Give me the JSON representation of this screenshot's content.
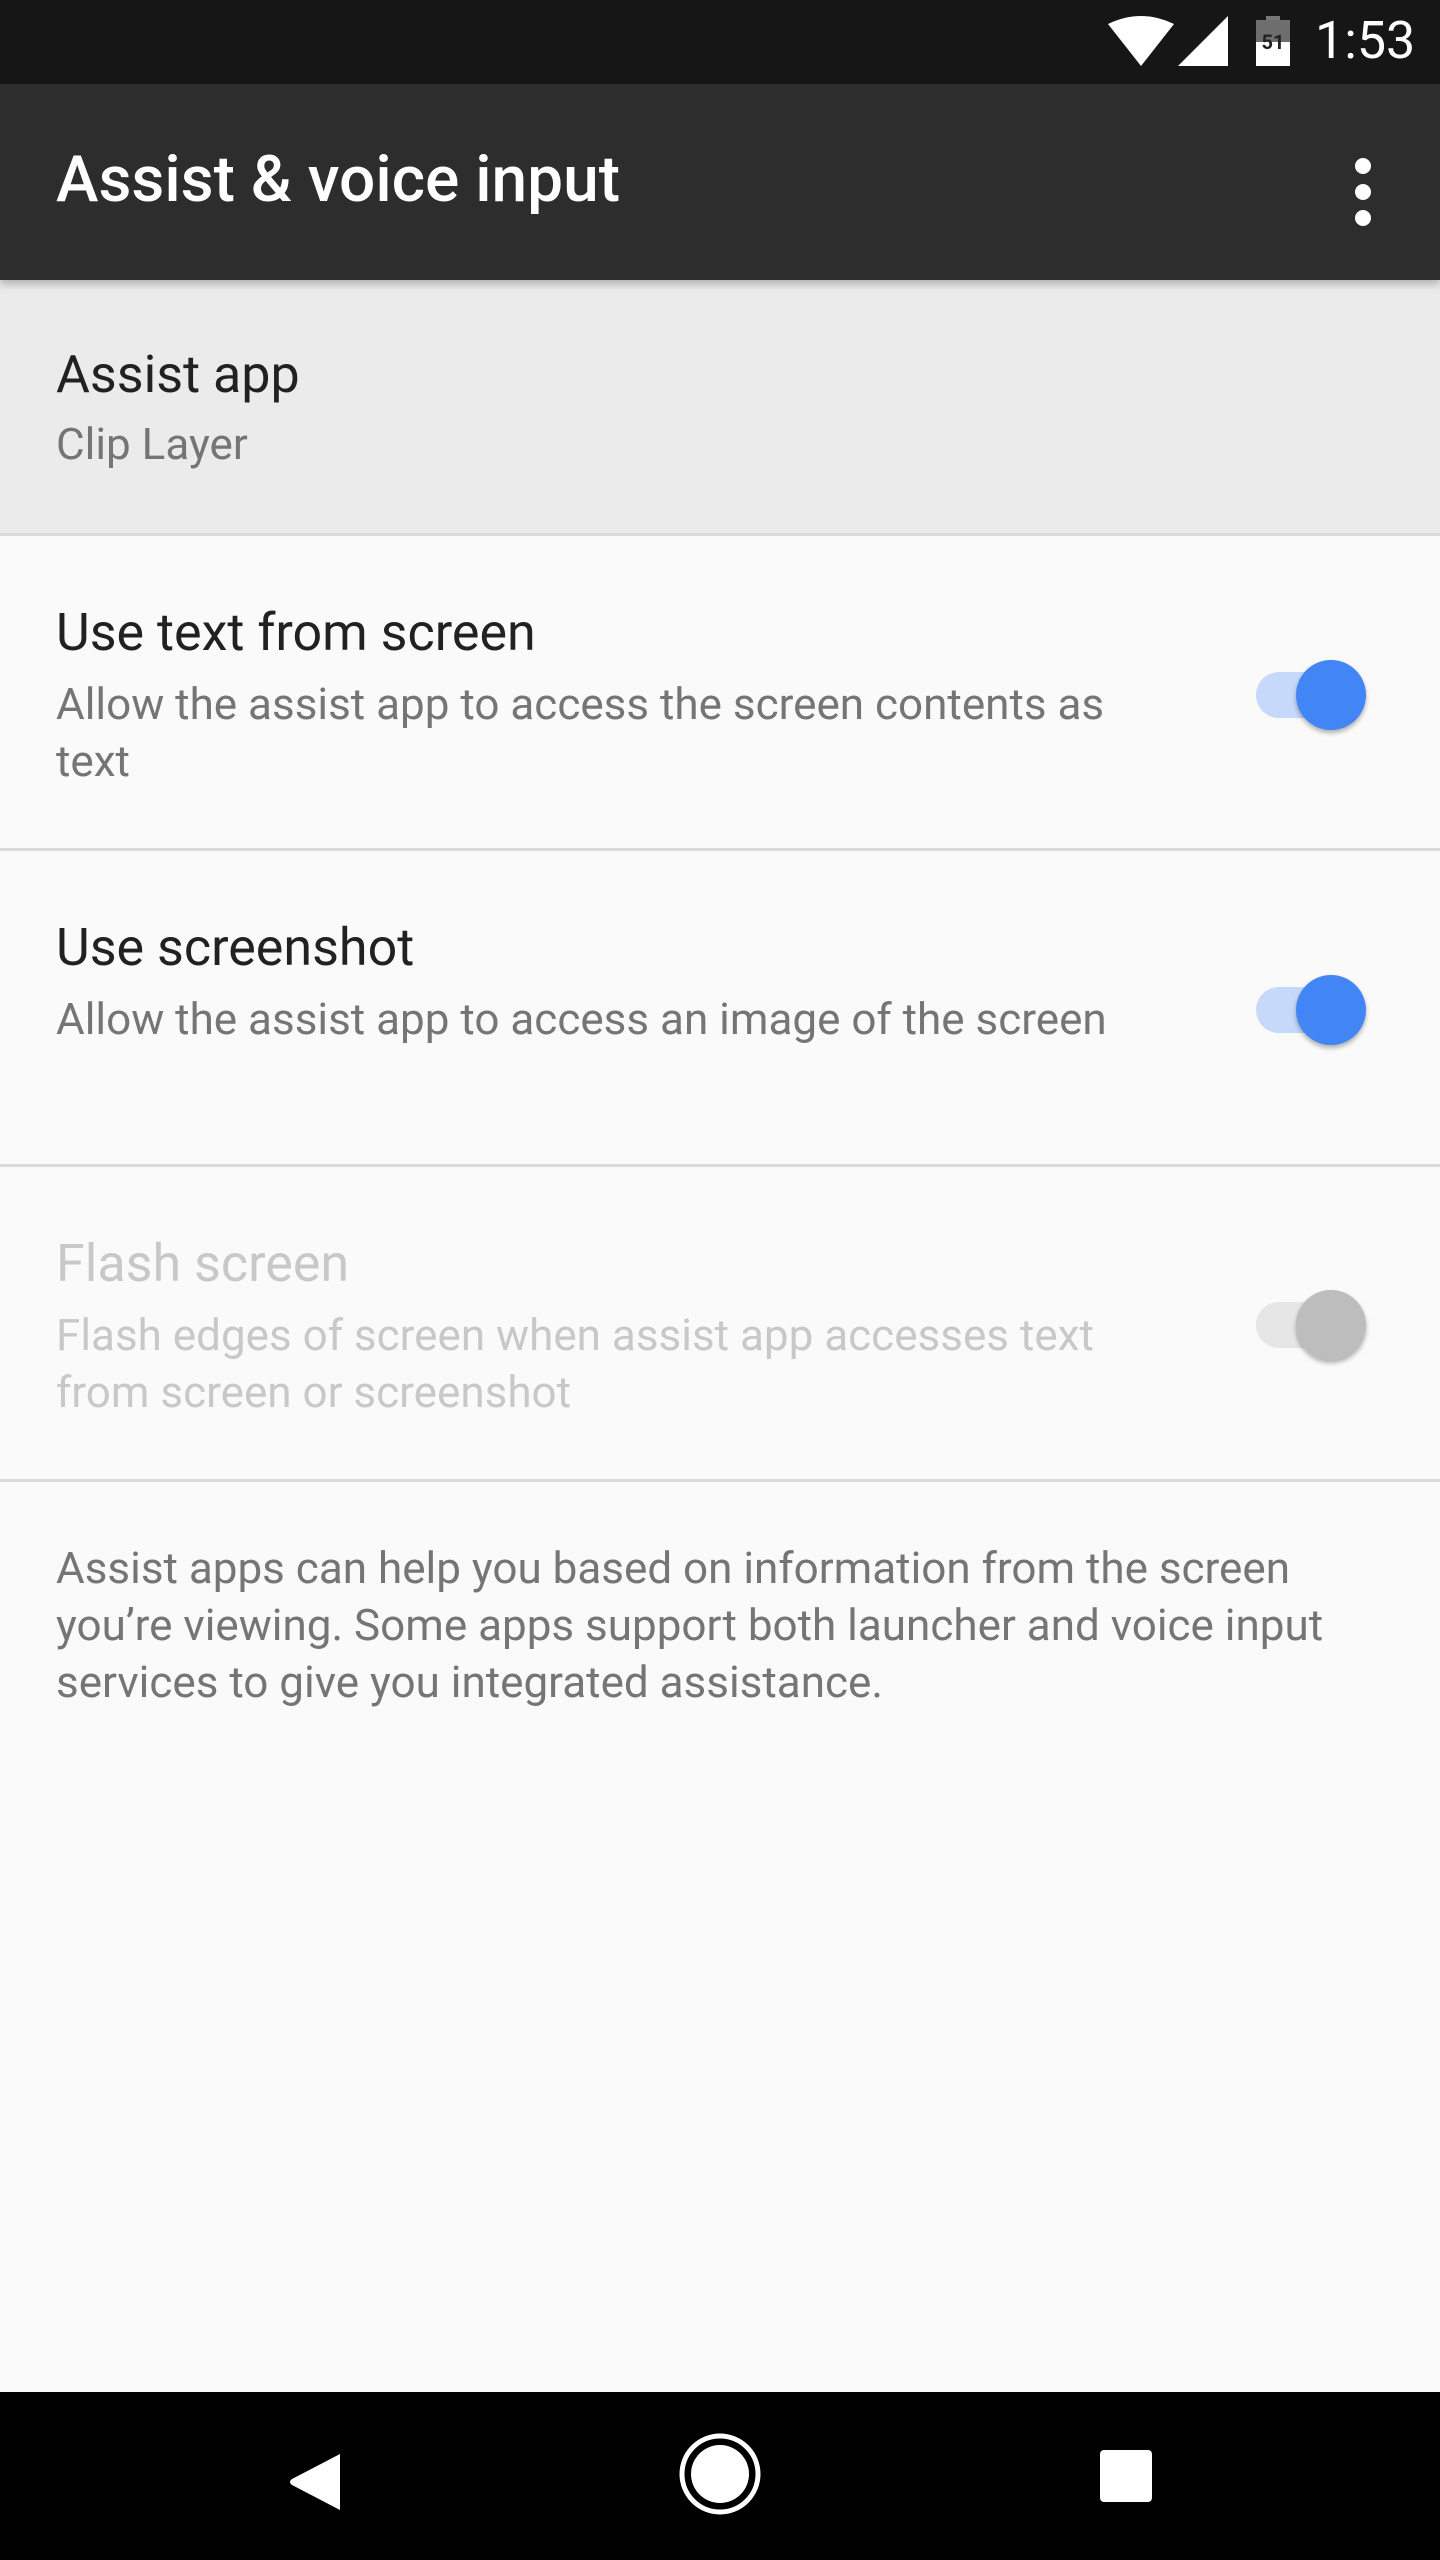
{
  "status_bar": {
    "time": "1:53",
    "battery_level": "51",
    "icons": [
      "wifi-icon",
      "cell-signal-icon",
      "battery-icon"
    ]
  },
  "toolbar": {
    "title": "Assist & voice input",
    "overflow_icon": "more-vert-icon"
  },
  "settings": [
    {
      "title": "Assist app",
      "summary": "Clip Layer",
      "type": "item"
    },
    {
      "title": "Use text from screen",
      "summary": "Allow the assist app to access the screen contents as text",
      "type": "switch",
      "checked": true,
      "enabled": true
    },
    {
      "title": "Use screenshot",
      "summary": "Allow the assist app to access an image of the screen",
      "type": "switch",
      "checked": true,
      "enabled": true
    },
    {
      "title": "Flash screen",
      "summary": "Flash edges of screen when assist app accesses text from screen or screenshot",
      "type": "switch",
      "checked": true,
      "enabled": false
    }
  ],
  "footer_text": "Assist apps can help you based on information from the screen you’re viewing. Some apps support both launcher and voice input services to give you integrated assistance.",
  "colors": {
    "accent": "#4285f4",
    "accent_track": "#c6d9fb",
    "disabled_thumb": "#bdbdbd",
    "disabled_track": "#e6e6e6",
    "toolbar": "#2d2d2d",
    "status_bar": "#161616"
  },
  "nav_bar": {
    "buttons": [
      "back-icon",
      "home-icon",
      "recents-icon"
    ]
  }
}
